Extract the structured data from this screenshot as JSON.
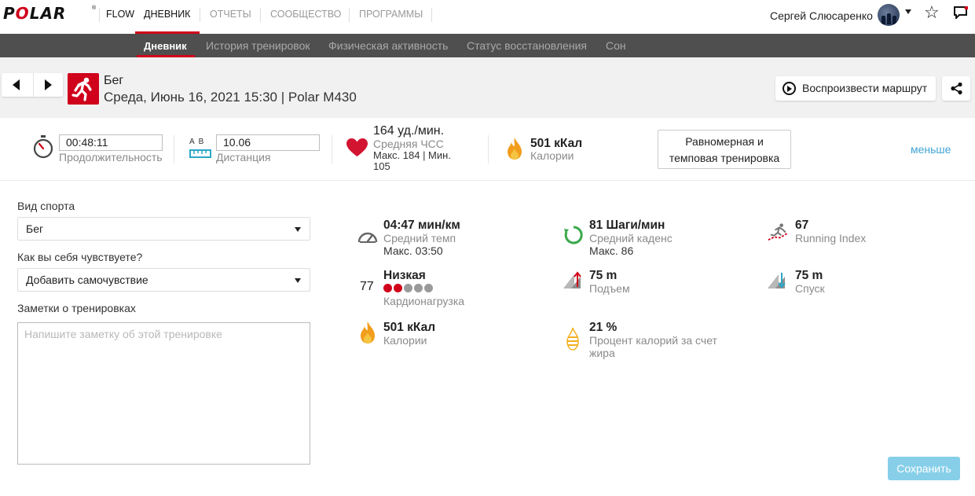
{
  "brand": {
    "name": "POLAR",
    "registered": "®"
  },
  "nav": {
    "flow": "FLOW",
    "items": [
      "ДНЕВНИК",
      "ОТЧЕТЫ",
      "СООБЩЕСТВО",
      "ПРОГРАММЫ"
    ],
    "active_color": "#d0021b"
  },
  "user": {
    "name": "Сергей Слюсаренко"
  },
  "subnav": {
    "items": [
      "Дневник",
      "История тренировок",
      "Физическая активность",
      "Статус восстановления",
      "Сон"
    ]
  },
  "session": {
    "sport": "Бег",
    "details": "Среда, Июнь 16, 2021 15:30 | Polar M430",
    "replay_label": "Воспроизвести маршрут"
  },
  "summary": {
    "duration_value": "00:48:11",
    "duration_label": "Продолжительность",
    "distance_ab": "A  B",
    "distance_value": "10.06",
    "distance_label": "Дистанция",
    "hr_value": "164 уд./мин.",
    "hr_label": "Средняя ЧСС",
    "hr_range_line1": "Макс. 184  |  Мин.",
    "hr_range_line2": "105",
    "calories_value": "501 кКал",
    "calories_label": "Калории",
    "type_line1": "Равномерная и",
    "type_line2": "темповая тренировка",
    "less_link": "меньше"
  },
  "form": {
    "sport_label": "Вид спорта",
    "sport_value": "Бег",
    "feeling_label": "Как вы себя чувствуете?",
    "feeling_value": "Добавить самочувствие",
    "notes_label": "Заметки о тренировках",
    "notes_placeholder": "Напишите заметку об этой тренировке",
    "save_label": "Сохранить"
  },
  "metrics": {
    "pace_value": "04:47 мин/км",
    "pace_label": "Средний темп",
    "pace_max": "Макс. 03:50",
    "cadence_value": "81 Шаги/мин",
    "cadence_label": "Средний каденс",
    "cadence_max": "Макс. 86",
    "running_index_value": "67",
    "running_index_label": "Running Index",
    "cardio_number": "77",
    "cardio_value": "Низкая",
    "cardio_label": "Кардионагрузка",
    "cardio_level": 2,
    "cardio_level_max": 5,
    "ascent_value": "75 m",
    "ascent_label": "Подъем",
    "descent_value": "75 m",
    "descent_label": "Спуск",
    "calories_value": "501 кКал",
    "calories_label": "Калории",
    "fat_value": "21 %",
    "fat_label_line1": "Процент калорий за счет",
    "fat_label_line2": "жира"
  },
  "colors": {
    "red": "#d0021b",
    "subnav_bg": "#4f4f4f",
    "link": "#3fa3d4",
    "save_bg": "#87cfe9",
    "dot_off": "#9a9a9a"
  }
}
